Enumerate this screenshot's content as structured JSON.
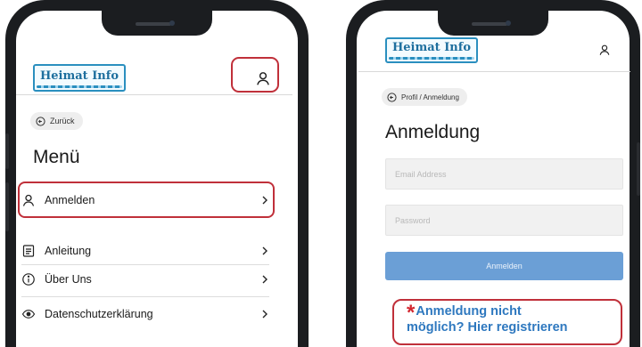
{
  "left_screen": {
    "logo_text": "Heimat Info",
    "back_label": "Zurück",
    "title": "Menü",
    "menu_items": [
      {
        "label": "Anmelden",
        "icon": "user-icon"
      },
      {
        "label": "Anleitung",
        "icon": "document-icon"
      },
      {
        "label": "Über Uns",
        "icon": "info-icon"
      },
      {
        "label": "Datenschutzerklärung",
        "icon": "eye-icon"
      }
    ],
    "profile_icon": "user-icon"
  },
  "right_screen": {
    "logo_text": "Heimat Info",
    "breadcrumb": "Profil / Anmeldung",
    "title": "Anmeldung",
    "email_placeholder": "Email Address",
    "password_placeholder": "Password",
    "submit_label": "Anmelden",
    "profile_icon": "user-icon"
  },
  "callout": {
    "star": "*",
    "text_line1": "Anmeldung nicht",
    "text_line2": "möglich? Hier registrieren"
  },
  "colors": {
    "highlight": "#c0303a",
    "brand_blue": "#2a8fbf",
    "button_blue": "#6b9fd6",
    "callout_text": "#2e78bf"
  }
}
